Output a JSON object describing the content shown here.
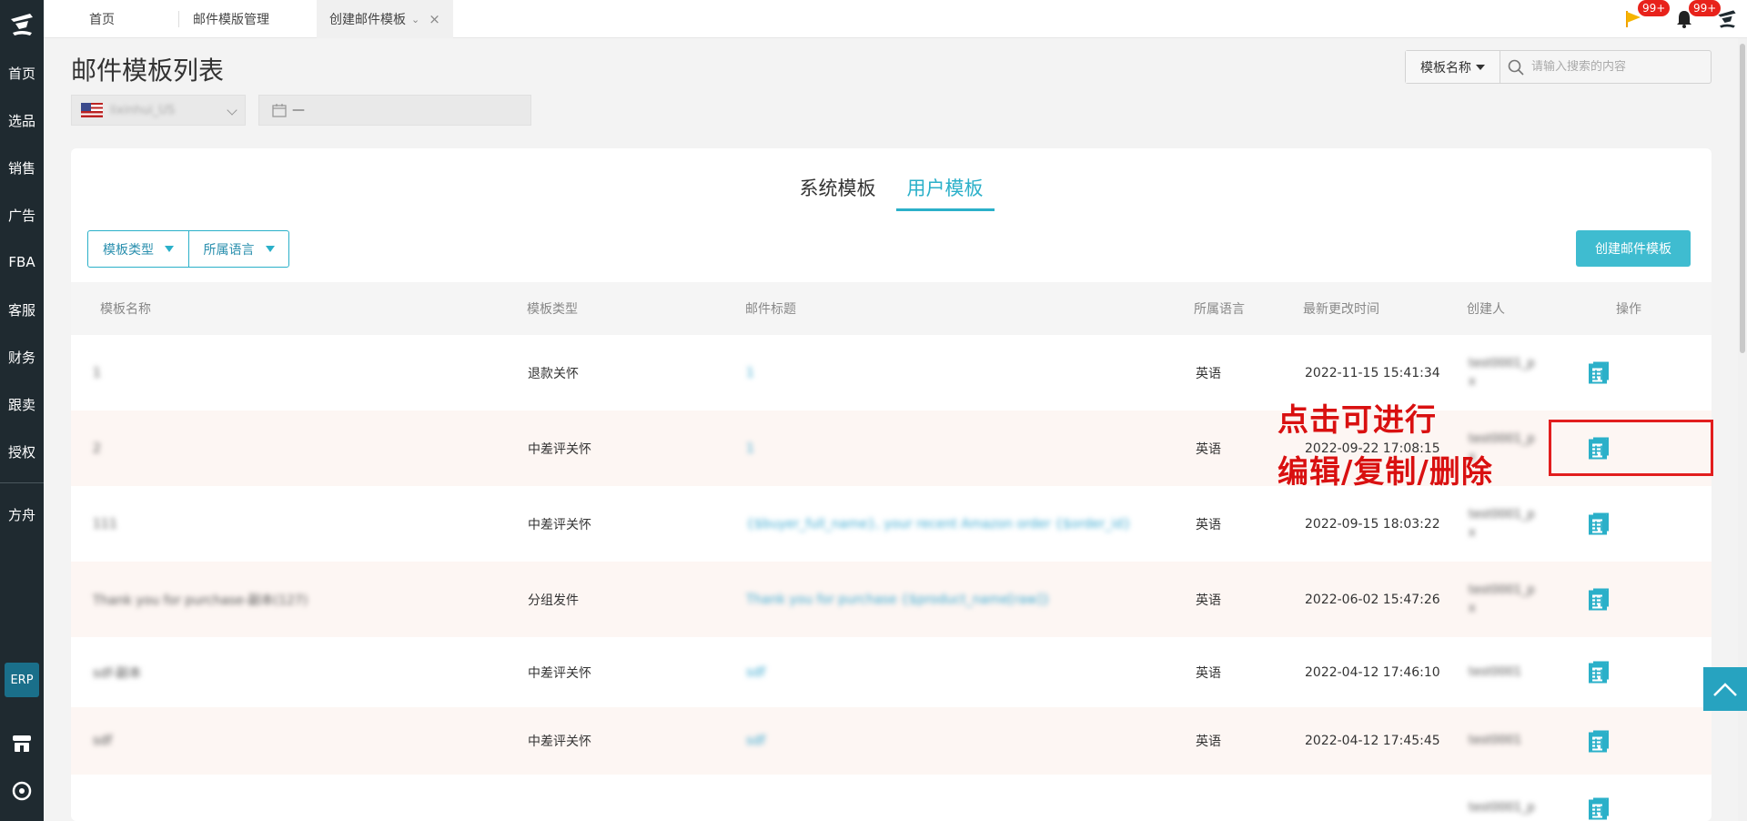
{
  "sidebar": {
    "items": [
      {
        "label": "首页"
      },
      {
        "label": "选品"
      },
      {
        "label": "销售"
      },
      {
        "label": "广告"
      },
      {
        "label": "FBA"
      },
      {
        "label": "客服"
      },
      {
        "label": "财务"
      },
      {
        "label": "跟卖"
      },
      {
        "label": "授权"
      },
      {
        "label": "方舟"
      }
    ],
    "erp_label": "ERP"
  },
  "topbar": {
    "tabs": [
      {
        "label": "首页"
      },
      {
        "label": "邮件模版管理"
      },
      {
        "label": "创建邮件模板"
      }
    ],
    "flag_badge": "99+",
    "bell_badge": "99+"
  },
  "page": {
    "title": "邮件模板列表",
    "shop_select_value": "lixinhui_US",
    "date_range_value": "—",
    "search_type": "模板名称",
    "search_placeholder": "请输入搜索的内容"
  },
  "card": {
    "tabs": [
      {
        "label": "系统模板",
        "active": false
      },
      {
        "label": "用户模板",
        "active": true
      }
    ],
    "filters": [
      {
        "label": "模板类型"
      },
      {
        "label": "所属语言"
      }
    ],
    "create_button": "创建邮件模板",
    "columns": [
      "模板名称",
      "模板类型",
      "邮件标题",
      "所属语言",
      "最新更改时间",
      "创建人",
      "操作"
    ],
    "rows": [
      {
        "name": "1",
        "type": "退款关怀",
        "subject": "1",
        "language": "英语",
        "time": "2022-11-15 15:41:34",
        "creator": "test0001_p",
        "creator2": "x"
      },
      {
        "name": "2",
        "type": "中差评关怀",
        "subject": "1",
        "language": "英语",
        "time": "2022-09-22 17:08:15",
        "creator": "test0001_p",
        "creator2": "x"
      },
      {
        "name": "111",
        "type": "中差评关怀",
        "subject": "{$buyer_full_name}, your recent Amazon order {$order_id}",
        "language": "英语",
        "time": "2022-09-15 18:03:22",
        "creator": "test0001_p",
        "creator2": "x"
      },
      {
        "name": "Thank you for purchase-副本(127)",
        "type": "分组发件",
        "subject": "Thank you for purchase {$product_name[raw]}",
        "language": "英语",
        "time": "2022-06-02 15:47:26",
        "creator": "test0001_p",
        "creator2": "x"
      },
      {
        "name": "sdf-副本",
        "type": "中差评关怀",
        "subject": "sdf",
        "language": "英语",
        "time": "2022-04-12 17:46:10",
        "creator": "test0001",
        "creator2": ""
      },
      {
        "name": "sdf",
        "type": "中差评关怀",
        "subject": "sdf",
        "language": "英语",
        "time": "2022-04-12 17:45:45",
        "creator": "test0001",
        "creator2": ""
      },
      {
        "name": "",
        "type": "",
        "subject": "",
        "language": "",
        "time": "",
        "creator": "test0001_p",
        "creator2": ""
      }
    ]
  },
  "annotation": {
    "line1": "点击可进行",
    "line2": "编辑/复制/删除"
  },
  "colors": {
    "accent": "#2bb0c9",
    "sidebar_bg": "#1f2a30",
    "annotation_red": "#e21e1e"
  }
}
